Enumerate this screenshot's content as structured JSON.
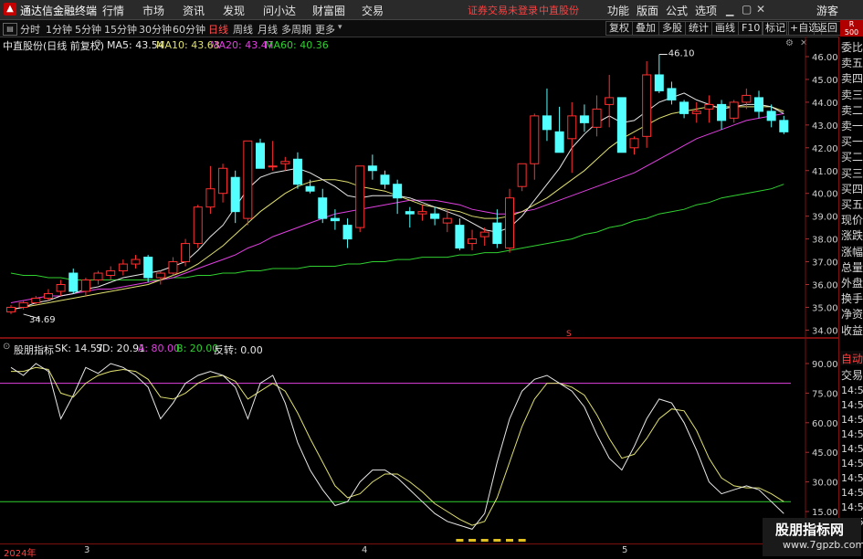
{
  "app": {
    "title": "通达信金融终端",
    "menu": [
      "行情",
      "市场",
      "资讯",
      "发现",
      "问小达",
      "财富圈",
      "交易"
    ],
    "warning": "证券交易未登录",
    "stock_name": "中直股份",
    "right_menu": [
      "功能",
      "版面",
      "公式",
      "选项"
    ],
    "guest": "游客",
    "badge_top": "R",
    "badge_bottom": "500"
  },
  "toolbar": {
    "timeframes": [
      "分时",
      "1分钟",
      "5分钟",
      "15分钟",
      "30分钟",
      "60分钟",
      "日线",
      "周线",
      "月线",
      "多周期",
      "更多"
    ],
    "active_timeframe": "日线",
    "buttons": [
      "复权",
      "叠加",
      "多股",
      "统计",
      "画线",
      "F10",
      "标记",
      "+自选",
      "返回"
    ]
  },
  "main_chart": {
    "header": "中直股份(日线 前复权)",
    "ma": [
      {
        "label": "MA5: 43.54",
        "color": "#e8e8e8"
      },
      {
        "label": "MA10: 43.63",
        "color": "#e0e070"
      },
      {
        "label": "MA20: 43.47",
        "color": "#e040e0"
      },
      {
        "label": "MA60: 40.36",
        "color": "#30d030"
      }
    ],
    "high_label": "46.10",
    "low_label": "34.69",
    "marker": "S",
    "y_ticks": [
      "46.00",
      "45.00",
      "44.00",
      "43.00",
      "42.00",
      "41.00",
      "40.00",
      "39.00",
      "38.00",
      "37.00",
      "36.00",
      "35.00",
      "34.00"
    ]
  },
  "indicator": {
    "name": "股朋指标",
    "values": [
      {
        "label": "SK: 14.57",
        "color": "#e8e8e8"
      },
      {
        "label": "SD: 20.91",
        "color": "#e8e8e8"
      },
      {
        "label": "A: 80.00",
        "color": "#e040e0"
      },
      {
        "label": "B: 20.00",
        "color": "#30d030"
      },
      {
        "label": "反转: 0.00",
        "color": "#e8e8e8"
      }
    ],
    "y_ticks": [
      "90.00",
      "75.00",
      "60.00",
      "45.00",
      "30.00",
      "15.00"
    ]
  },
  "x_axis": {
    "labels": [
      "2024年",
      "3",
      "4",
      "5"
    ]
  },
  "sidebar_quote": [
    "委比",
    "卖五",
    "卖四",
    "卖三",
    "卖二",
    "卖一",
    "买一",
    "买二",
    "买三",
    "买四",
    "买五",
    "现价",
    "涨跌",
    "涨幅",
    "总量",
    "外盘",
    "换手",
    "净资",
    "收益"
  ],
  "sidebar_lower": {
    "auto": "自动",
    "trade": "交易",
    "times": [
      "14:56",
      "14:56",
      "14:56",
      "14:56",
      "14:56",
      "14:56",
      "14:56",
      "14:56",
      "14:56",
      "14:56"
    ]
  },
  "watermark": {
    "line1": "股朋指标网",
    "line2": "www.7gpzb.com"
  },
  "colors": {
    "up": "#ff3030",
    "down": "#54ffff",
    "ma5": "#e8e8e8",
    "ma10": "#e0e070",
    "ma20": "#e040e0",
    "ma60": "#30d030"
  },
  "chart_data": {
    "type": "candlestick",
    "candles": [
      [
        34.8,
        35.1,
        34.7,
        35.0
      ],
      [
        35.0,
        35.3,
        34.9,
        35.2
      ],
      [
        35.2,
        35.5,
        35.1,
        35.4
      ],
      [
        35.4,
        35.8,
        35.3,
        35.6
      ],
      [
        35.7,
        36.2,
        35.5,
        36.0
      ],
      [
        36.5,
        36.7,
        35.6,
        35.7
      ],
      [
        35.7,
        36.3,
        35.5,
        36.2
      ],
      [
        36.2,
        36.6,
        36.0,
        36.5
      ],
      [
        36.4,
        36.8,
        36.2,
        36.6
      ],
      [
        36.6,
        37.1,
        36.4,
        36.9
      ],
      [
        36.9,
        37.3,
        36.7,
        37.1
      ],
      [
        37.2,
        37.3,
        36.1,
        36.3
      ],
      [
        36.3,
        36.6,
        36.0,
        36.5
      ],
      [
        36.5,
        37.2,
        36.4,
        37.0
      ],
      [
        37.0,
        38.0,
        36.8,
        37.8
      ],
      [
        37.8,
        39.5,
        37.6,
        39.4
      ],
      [
        39.4,
        41.2,
        39.1,
        40.2
      ],
      [
        40.0,
        41.3,
        39.6,
        41.1
      ],
      [
        40.7,
        41.0,
        38.7,
        39.2
      ],
      [
        38.9,
        42.3,
        38.6,
        42.3
      ],
      [
        42.2,
        42.4,
        41.1,
        41.1
      ],
      [
        41.2,
        42.3,
        41.0,
        41.2
      ],
      [
        41.3,
        41.6,
        41.0,
        41.4
      ],
      [
        41.5,
        41.8,
        40.2,
        40.4
      ],
      [
        40.3,
        40.6,
        40.0,
        40.1
      ],
      [
        39.8,
        40.2,
        38.7,
        38.9
      ],
      [
        38.9,
        39.3,
        38.4,
        38.8
      ],
      [
        38.6,
        38.9,
        37.6,
        38.0
      ],
      [
        38.5,
        41.2,
        38.3,
        41.2
      ],
      [
        41.2,
        41.7,
        40.6,
        41.0
      ],
      [
        40.8,
        41.0,
        40.2,
        40.4
      ],
      [
        40.4,
        40.6,
        39.1,
        39.8
      ],
      [
        39.2,
        39.4,
        38.5,
        39.1
      ],
      [
        39.1,
        39.5,
        38.8,
        39.2
      ],
      [
        39.1,
        39.4,
        38.6,
        38.9
      ],
      [
        38.7,
        39.3,
        38.3,
        38.9
      ],
      [
        38.6,
        38.9,
        37.5,
        37.6
      ],
      [
        37.8,
        38.4,
        37.5,
        38.0
      ],
      [
        38.1,
        38.5,
        37.7,
        38.3
      ],
      [
        38.7,
        39.3,
        37.6,
        37.8
      ],
      [
        37.6,
        40.2,
        37.4,
        39.8
      ],
      [
        40.3,
        41.3,
        40.1,
        41.3
      ],
      [
        41.3,
        43.5,
        40.6,
        43.4
      ],
      [
        43.4,
        44.6,
        42.3,
        42.8
      ],
      [
        42.7,
        43.8,
        41.8,
        41.8
      ],
      [
        42.4,
        44.0,
        40.9,
        43.4
      ],
      [
        43.4,
        43.9,
        42.7,
        43.1
      ],
      [
        42.9,
        44.3,
        42.5,
        43.7
      ],
      [
        43.9,
        45.2,
        42.9,
        44.2
      ],
      [
        44.2,
        44.2,
        41.9,
        41.8
      ],
      [
        42.0,
        42.5,
        41.7,
        42.4
      ],
      [
        42.5,
        45.8,
        42.0,
        45.2
      ],
      [
        45.2,
        46.1,
        44.4,
        44.5
      ],
      [
        44.6,
        44.9,
        43.9,
        44.1
      ],
      [
        44.0,
        44.1,
        43.3,
        43.5
      ],
      [
        43.5,
        44.0,
        43.1,
        43.6
      ],
      [
        43.7,
        44.3,
        43.1,
        43.9
      ],
      [
        43.9,
        44.1,
        42.8,
        43.2
      ],
      [
        43.3,
        44.1,
        43.1,
        44.0
      ],
      [
        44.0,
        44.6,
        43.7,
        44.3
      ],
      [
        44.2,
        44.5,
        43.3,
        43.6
      ],
      [
        43.6,
        43.9,
        42.9,
        43.2
      ],
      [
        43.2,
        43.4,
        42.6,
        42.7
      ]
    ],
    "ma5": [
      34.9,
      35.0,
      35.2,
      35.3,
      35.5,
      35.6,
      35.8,
      35.9,
      36.1,
      36.3,
      36.4,
      36.5,
      36.6,
      36.8,
      37.0,
      37.5,
      38.1,
      38.6,
      39.4,
      40.2,
      40.7,
      40.9,
      41.0,
      41.1,
      40.9,
      40.6,
      40.3,
      39.9,
      39.8,
      39.9,
      39.9,
      39.9,
      39.8,
      39.6,
      39.4,
      39.2,
      39.0,
      38.7,
      38.4,
      38.3,
      38.5,
      39.0,
      39.7,
      40.4,
      41.1,
      42.0,
      42.6,
      43.1,
      43.4,
      43.1,
      43.2,
      43.6,
      44.0,
      44.2,
      44.4,
      44.1,
      43.9,
      43.7,
      43.8,
      43.9,
      43.9,
      43.8,
      43.5
    ],
    "ma10": [
      34.9,
      35.0,
      35.1,
      35.2,
      35.3,
      35.4,
      35.5,
      35.6,
      35.7,
      35.8,
      35.9,
      36.0,
      36.2,
      36.4,
      36.6,
      36.9,
      37.3,
      37.7,
      38.2,
      38.7,
      39.2,
      39.6,
      40.0,
      40.3,
      40.5,
      40.6,
      40.6,
      40.5,
      40.3,
      40.2,
      40.1,
      39.9,
      39.7,
      39.5,
      39.4,
      39.3,
      39.2,
      39.0,
      38.9,
      38.9,
      39.0,
      39.2,
      39.5,
      39.8,
      40.2,
      40.6,
      41.0,
      41.5,
      42.0,
      42.4,
      42.7,
      43.0,
      43.3,
      43.5,
      43.6,
      43.7,
      43.8,
      43.8,
      43.8,
      43.8,
      43.8,
      43.8,
      43.6
    ],
    "ma20": [
      35.2,
      35.3,
      35.4,
      35.5,
      35.5,
      35.6,
      35.7,
      35.8,
      35.8,
      35.9,
      36.0,
      36.1,
      36.2,
      36.3,
      36.5,
      36.7,
      36.9,
      37.1,
      37.3,
      37.6,
      37.8,
      38.1,
      38.3,
      38.5,
      38.7,
      38.9,
      39.1,
      39.2,
      39.3,
      39.4,
      39.5,
      39.6,
      39.7,
      39.7,
      39.7,
      39.6,
      39.5,
      39.3,
      39.2,
      39.1,
      39.1,
      39.2,
      39.3,
      39.5,
      39.7,
      39.9,
      40.1,
      40.3,
      40.5,
      40.7,
      40.9,
      41.2,
      41.5,
      41.8,
      42.1,
      42.4,
      42.6,
      42.8,
      43.0,
      43.2,
      43.3,
      43.4,
      43.5
    ],
    "ma60": [
      36.5,
      36.4,
      36.4,
      36.3,
      36.3,
      36.2,
      36.2,
      36.2,
      36.2,
      36.2,
      36.2,
      36.2,
      36.2,
      36.3,
      36.3,
      36.4,
      36.4,
      36.5,
      36.5,
      36.6,
      36.6,
      36.7,
      36.7,
      36.7,
      36.8,
      36.8,
      36.8,
      36.9,
      36.9,
      37.0,
      37.0,
      37.1,
      37.1,
      37.2,
      37.2,
      37.2,
      37.3,
      37.3,
      37.4,
      37.4,
      37.5,
      37.6,
      37.7,
      37.8,
      37.9,
      38.0,
      38.2,
      38.3,
      38.5,
      38.6,
      38.8,
      38.9,
      39.1,
      39.2,
      39.3,
      39.5,
      39.6,
      39.8,
      39.9,
      40.0,
      40.1,
      40.2,
      40.4
    ],
    "sk": [
      88,
      84,
      90,
      86,
      62,
      74,
      88,
      85,
      90,
      88,
      84,
      78,
      62,
      70,
      80,
      84,
      86,
      84,
      78,
      62,
      80,
      84,
      70,
      50,
      36,
      26,
      18,
      20,
      30,
      36,
      36,
      32,
      26,
      20,
      14,
      10,
      8,
      6,
      14,
      40,
      62,
      76,
      82,
      84,
      80,
      76,
      68,
      54,
      42,
      36,
      48,
      62,
      72,
      70,
      60,
      46,
      30,
      24,
      26,
      28,
      26,
      20,
      14
    ],
    "sd": [
      86,
      86,
      88,
      87,
      75,
      73,
      80,
      84,
      86,
      87,
      86,
      82,
      73,
      72,
      75,
      80,
      83,
      84,
      81,
      72,
      76,
      80,
      76,
      65,
      52,
      40,
      28,
      22,
      24,
      30,
      34,
      34,
      30,
      25,
      19,
      15,
      11,
      8,
      10,
      22,
      40,
      58,
      72,
      80,
      80,
      78,
      74,
      64,
      52,
      42,
      44,
      52,
      62,
      67,
      66,
      56,
      42,
      32,
      28,
      27,
      27,
      24,
      20
    ],
    "A": 80,
    "B": 20
  }
}
